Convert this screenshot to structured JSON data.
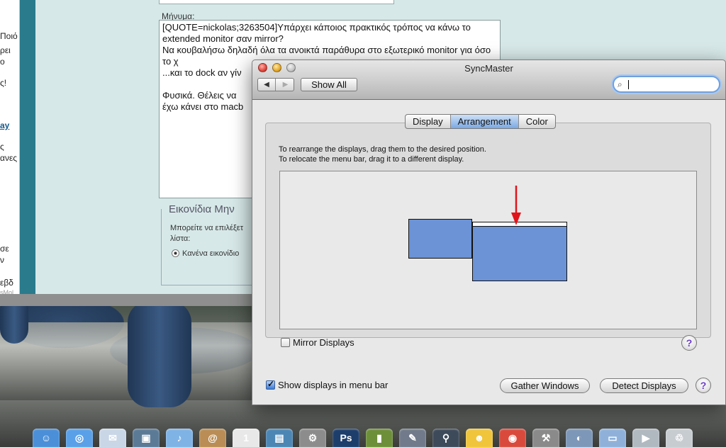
{
  "browser": {
    "left_snippets": [
      "Ποιό",
      "ρει",
      "ο",
      "ς!",
      "ay",
      "ς",
      "ανες",
      "σε",
      "ν",
      "εβδ",
      "sMol"
    ],
    "message_label": "Μήνυμα:",
    "message_text": "[QUOTE=nickolas;3263504]Υπάρχει κάποιος πρακτικός τρόπος να κάνω το extended monitor σαν mirror?\nΝα κουβαλήσω δηλαδή όλα τα ανοικτά παράθυρα στο εξωτερικό monitor για όσο το χ\n...και το dock αν γίν\n\nΦυσικά. Θέλεις να\nέχω κάνει στο macb",
    "fieldset_legend": "Εικονίδια Μην",
    "fieldset_text": "Μπορείτε να επιλέξετ λίστα:",
    "radio_label": "Κανένα εικονίδιο"
  },
  "window": {
    "title": "SyncMaster",
    "nav_back": "◀",
    "nav_forward": "▶",
    "show_all": "Show All",
    "search_placeholder": "",
    "tabs": [
      {
        "label": "Display",
        "active": false
      },
      {
        "label": "Arrangement",
        "active": true
      },
      {
        "label": "Color",
        "active": false
      }
    ],
    "instructions_line1": "To rearrange the displays, drag them to the desired position.",
    "instructions_line2": "To relocate the menu bar, drag it to a different display.",
    "mirror_label": "Mirror Displays",
    "mirror_checked": false,
    "show_in_menubar_label": "Show displays in menu bar",
    "show_in_menubar_checked": true,
    "gather_windows": "Gather Windows",
    "detect_displays": "Detect Displays",
    "help": "?"
  },
  "dock": {
    "items": [
      {
        "icon": "finder-icon",
        "color": "#4a8fd8",
        "glyph": "☺"
      },
      {
        "icon": "safari-icon",
        "color": "#5aa0e8",
        "glyph": "◎"
      },
      {
        "icon": "mail-icon",
        "color": "#c9d6e6",
        "glyph": "✉"
      },
      {
        "icon": "photo-icon",
        "color": "#5b7a96",
        "glyph": "▣"
      },
      {
        "icon": "itunes-icon",
        "color": "#7fb3e6",
        "glyph": "♪"
      },
      {
        "icon": "address-book-icon",
        "color": "#b98d55",
        "glyph": "@"
      },
      {
        "icon": "ical-icon",
        "color": "#e8e8e8",
        "glyph": "1"
      },
      {
        "icon": "iphoto-icon",
        "color": "#4c86b4",
        "glyph": "▤"
      },
      {
        "icon": "preferences-icon",
        "color": "#8c8c8c",
        "glyph": "⚙"
      },
      {
        "icon": "photoshop-icon",
        "color": "#1d3d6b",
        "glyph": "Ps"
      },
      {
        "icon": "stats-icon",
        "color": "#6d8f3a",
        "glyph": "▮"
      },
      {
        "icon": "script-icon",
        "color": "#707a8a",
        "glyph": "✎"
      },
      {
        "icon": "binoculars-icon",
        "color": "#3d4a5a",
        "glyph": "⚲"
      },
      {
        "icon": "messenger-icon",
        "color": "#f0c53c",
        "glyph": "☻"
      },
      {
        "icon": "chrome-icon",
        "color": "#d94a3c",
        "glyph": "◉"
      },
      {
        "icon": "plugin-icon",
        "color": "#8a8a8a",
        "glyph": "⚒"
      },
      {
        "icon": "browser-icon",
        "color": "#7d97b8",
        "glyph": "◐"
      },
      {
        "icon": "folder-icon",
        "color": "#8fb1d9",
        "glyph": "▭"
      },
      {
        "icon": "preview-icon",
        "color": "#b0b8c0",
        "glyph": "▶"
      },
      {
        "icon": "trash-icon",
        "color": "#c7ccd1",
        "glyph": "♲"
      }
    ]
  }
}
